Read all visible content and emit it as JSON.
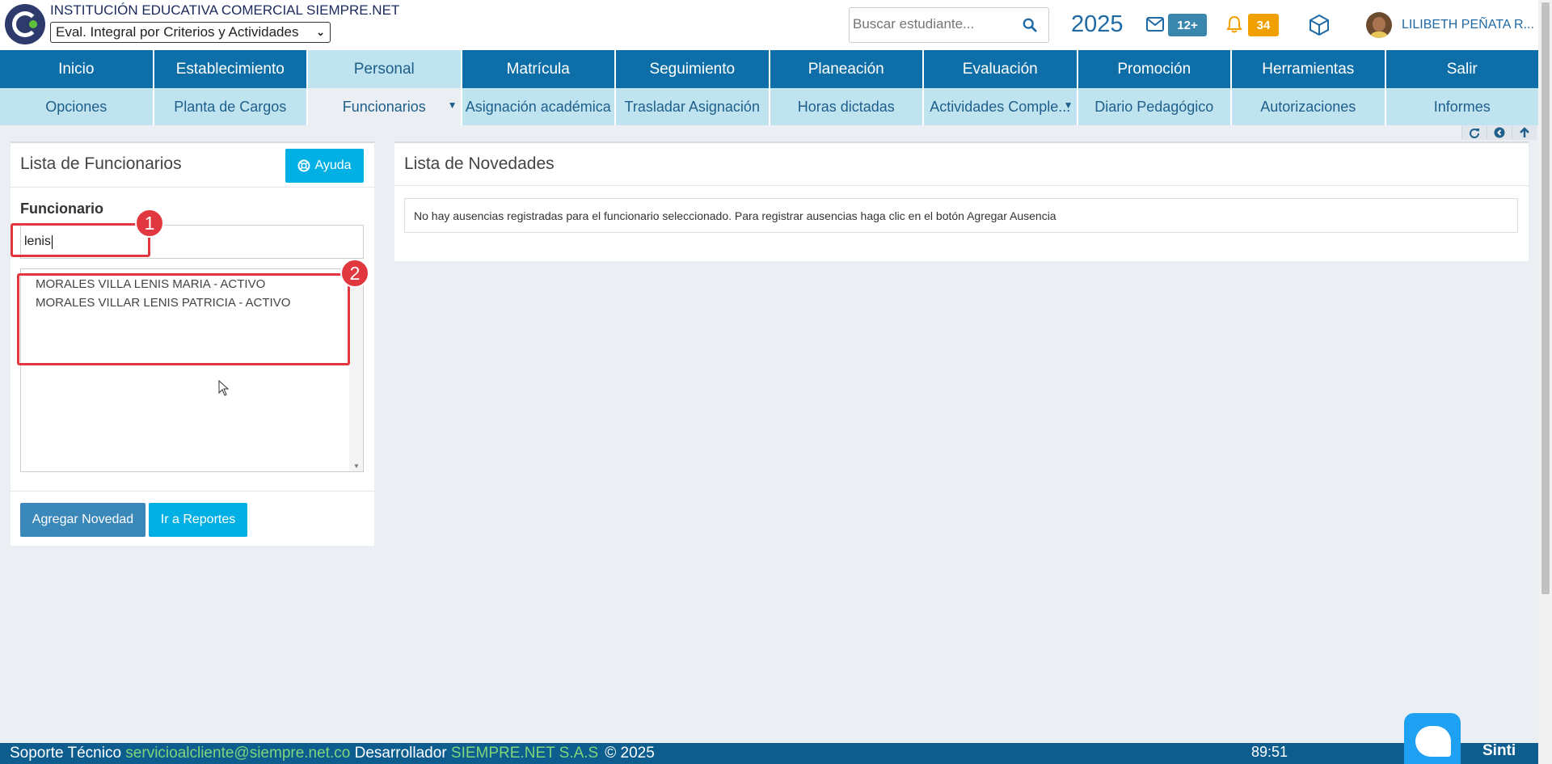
{
  "header": {
    "institution": "INSTITUCIÓN EDUCATIVA COMERCIAL SIEMPRE.NET",
    "eval_select": "Eval. Integral por Criterios y Actividades",
    "search_placeholder": "Buscar estudiante...",
    "year": "2025",
    "messages_badge": "12+",
    "notifications_badge": "34",
    "user_name": "LILIBETH PEÑATA R..."
  },
  "nav_main": [
    "Inicio",
    "Establecimiento",
    "Personal",
    "Matrícula",
    "Seguimiento",
    "Planeación",
    "Evaluación",
    "Promoción",
    "Herramientas",
    "Salir"
  ],
  "nav_main_active": "Personal",
  "nav_sub": [
    "Opciones",
    "Planta de Cargos",
    "Funcionarios",
    "Asignación académica",
    "Trasladar Asignación",
    "Horas dictadas",
    "Actividades Comple...",
    "Diario Pedagógico",
    "Autorizaciones",
    "Informes"
  ],
  "nav_sub_active": "Funcionarios",
  "left_panel": {
    "title": "Lista de Funcionarios",
    "help_button": "Ayuda",
    "field_label": "Funcionario",
    "search_value": "lenis",
    "options": [
      "MORALES VILLA LENIS MARIA - ACTIVO",
      "MORALES VILLAR LENIS PATRICIA - ACTIVO"
    ],
    "add_button": "Agregar Novedad",
    "reports_button": "Ir a Reportes"
  },
  "right_panel": {
    "title": "Lista de Novedades",
    "message": "No hay ausencias registradas para el funcionario seleccionado. Para registrar ausencias haga clic en el botón Agregar Ausencia"
  },
  "annotations": [
    "1",
    "2"
  ],
  "footer": {
    "support_label": "Soporte Técnico",
    "support_email": "servicioalcliente@siempre.net.co",
    "dev_label": "Desarrollador",
    "dev_name": "SIEMPRE.NET S.A.S",
    "copyright": "© 2025",
    "timer": "89:51",
    "brand": "Sinti"
  },
  "colors": {
    "nav_primary": "#0d6ea8",
    "nav_secondary": "#bfe3ef",
    "accent_cyan": "#00b0e4",
    "annotation_red": "#e0383e",
    "badge_orange": "#f0a000"
  }
}
